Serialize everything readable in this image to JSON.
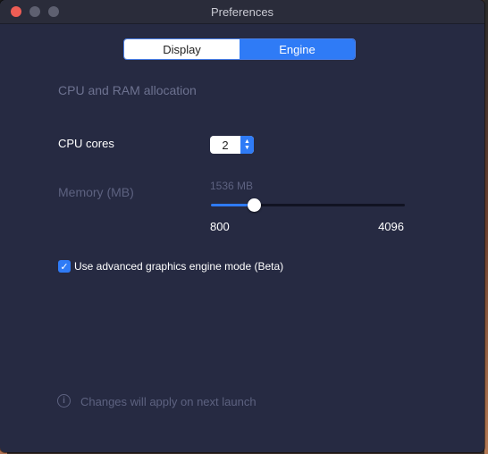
{
  "window": {
    "title": "Preferences"
  },
  "tabs": {
    "display": "Display",
    "engine": "Engine",
    "selected": "Engine"
  },
  "section": {
    "title": "CPU and RAM allocation"
  },
  "cpu": {
    "label": "CPU cores",
    "value": "2"
  },
  "memory": {
    "label": "Memory (MB)",
    "current": "1536 MB",
    "min_label": "800",
    "max_label": "4096",
    "value": 1536,
    "min": 800,
    "max": 4096
  },
  "advanced": {
    "label": "Use advanced graphics engine mode (Beta)",
    "checked": true
  },
  "footer": {
    "note": "Changes will apply on next launch"
  },
  "colors": {
    "accent": "#2f7bf6",
    "window_bg": "#262a42",
    "close": "#ee5d55"
  }
}
